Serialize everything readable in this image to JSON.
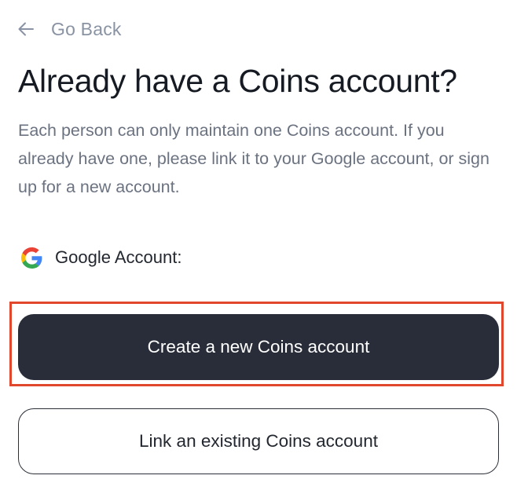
{
  "nav": {
    "back_label": "Go Back",
    "back_icon": "arrow-left-icon"
  },
  "heading": {
    "title": "Already have a Coins account?",
    "description": "Each person can only maintain one Coins account. If you already have one, please link it to your Google account, or sign up for a new account."
  },
  "account": {
    "provider_icon": "google-icon",
    "label": "Google Account:"
  },
  "actions": {
    "create_label": "Create a new Coins account",
    "link_label": "Link an existing Coins account"
  },
  "colors": {
    "primary_button": "#282d39",
    "highlight_border": "#e0472d",
    "muted_text": "#6b7280"
  }
}
